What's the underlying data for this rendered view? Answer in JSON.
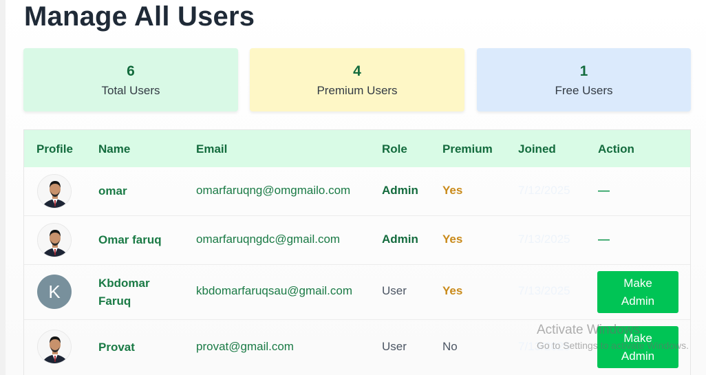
{
  "header": {
    "title": "Manage All Users"
  },
  "stats": [
    {
      "value": "6",
      "label": "Total Users",
      "color": "#d9f9e6"
    },
    {
      "value": "4",
      "label": "Premium Users",
      "color": "#fef7c6"
    },
    {
      "value": "1",
      "label": "Free Users",
      "color": "#dbeafc"
    }
  ],
  "table": {
    "columns": [
      "Profile",
      "Name",
      "Email",
      "Role",
      "Premium",
      "Joined",
      "Action"
    ],
    "rows": [
      {
        "name": "omar",
        "email": "omarfaruqng@omgmailo.com",
        "role": "Admin",
        "premium": "Yes",
        "joined": "7/12/2025",
        "action": "—",
        "avatar": "photo"
      },
      {
        "name": "Omar faruq",
        "email": "omarfaruqngdc@gmail.com",
        "role": "Admin",
        "premium": "Yes",
        "joined": "7/13/2025",
        "action": "—",
        "avatar": "photo"
      },
      {
        "name_line1": "Kbdomar",
        "name_line2": "Faruq",
        "email": "kbdomarfaruqsau@gmail.com",
        "role": "User",
        "premium": "Yes",
        "joined": "7/13/2025",
        "action_line1": "Make",
        "action_line2": "Admin",
        "avatar_letter": "K"
      },
      {
        "name": "Provat",
        "email": "provat@gmail.com",
        "role": "User",
        "premium": "No",
        "joined": "7/13/2025",
        "action_line1": "Make",
        "action_line2": "Admin",
        "avatar": "photo"
      }
    ]
  },
  "watermark": {
    "line1": "Activate Windows",
    "line2": "Go to Settings to activate Windows."
  },
  "colors": {
    "accent": "#00c455",
    "header_text": "#136b3d",
    "premium_yes": "#c98a1a"
  }
}
